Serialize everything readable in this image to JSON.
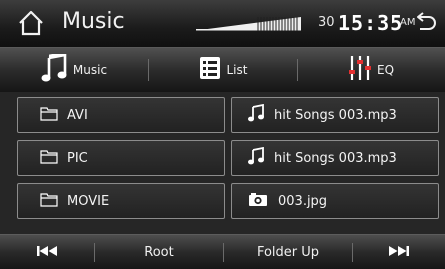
{
  "header": {
    "title": "Music",
    "volume_level": "30",
    "time": "15:35",
    "ampm": "AM",
    "icons": {
      "home": "home-icon",
      "back": "back-arrow-icon",
      "volume": "volume-bars-icon"
    }
  },
  "tabs": [
    {
      "label": "Music",
      "icon": "music-note-icon"
    },
    {
      "label": "List",
      "icon": "list-icon"
    },
    {
      "label": "EQ",
      "icon": "equalizer-icon"
    }
  ],
  "folders": [
    {
      "label": "AVI",
      "icon": "folder-icon"
    },
    {
      "label": "PIC",
      "icon": "folder-icon"
    },
    {
      "label": "MOVIE",
      "icon": "folder-icon"
    }
  ],
  "files": [
    {
      "label": "hit Songs 003.mp3",
      "icon": "music-note-icon"
    },
    {
      "label": "hit Songs 003.mp3",
      "icon": "music-note-icon"
    },
    {
      "label": "003.jpg",
      "icon": "camera-icon"
    }
  ],
  "bottom": {
    "prev_icon": "previous-icon",
    "root_label": "Root",
    "folder_up_label": "Folder Up",
    "next_icon": "next-icon"
  },
  "colors": {
    "background": "#202020",
    "cell_border": "#8c8c8c",
    "text": "#ffffff"
  }
}
